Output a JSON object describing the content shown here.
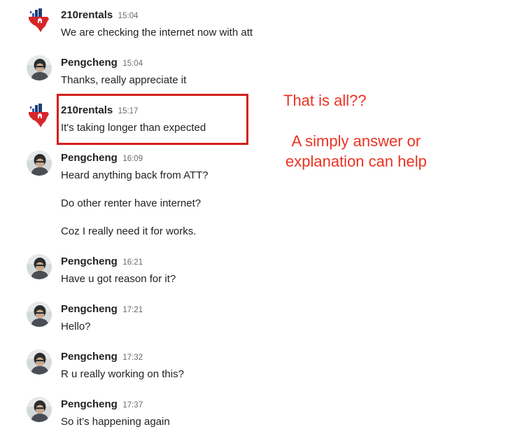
{
  "colors": {
    "annotation_red": "#ea3323",
    "box_red": "#d42019",
    "text": "#222222",
    "timestamp": "#6a6a6a"
  },
  "messages": [
    {
      "sender": "210rentals",
      "avatar": "house-logo-icon",
      "time": "15:04",
      "lines": [
        "We are checking the internet now with att"
      ]
    },
    {
      "sender": "Pengcheng",
      "avatar": "user-photo-icon",
      "time": "15:04",
      "lines": [
        "Thanks, really appreciate it"
      ]
    },
    {
      "sender": "210rentals",
      "avatar": "house-logo-icon",
      "time": "15:17",
      "lines": [
        "It's taking longer than expected"
      ]
    },
    {
      "sender": "Pengcheng",
      "avatar": "user-photo-icon",
      "time": "16:09",
      "lines": [
        "Heard anything back from ATT?",
        "Do other renter have internet?",
        "Coz I really need it for works."
      ]
    },
    {
      "sender": "Pengcheng",
      "avatar": "user-photo-icon",
      "time": "16:21",
      "lines": [
        "Have u got reason for it?"
      ]
    },
    {
      "sender": "Pengcheng",
      "avatar": "user-photo-icon",
      "time": "17:21",
      "lines": [
        "Hello?"
      ]
    },
    {
      "sender": "Pengcheng",
      "avatar": "user-photo-icon",
      "time": "17:32",
      "lines": [
        "R u really working on this?"
      ]
    },
    {
      "sender": "Pengcheng",
      "avatar": "user-photo-icon",
      "time": "17:37",
      "lines": [
        "So it’s happening again"
      ]
    }
  ],
  "annotations": {
    "label_1": "That is all??",
    "label_2_line_1": "A simply answer or",
    "label_2_line_2": "explanation can help"
  }
}
